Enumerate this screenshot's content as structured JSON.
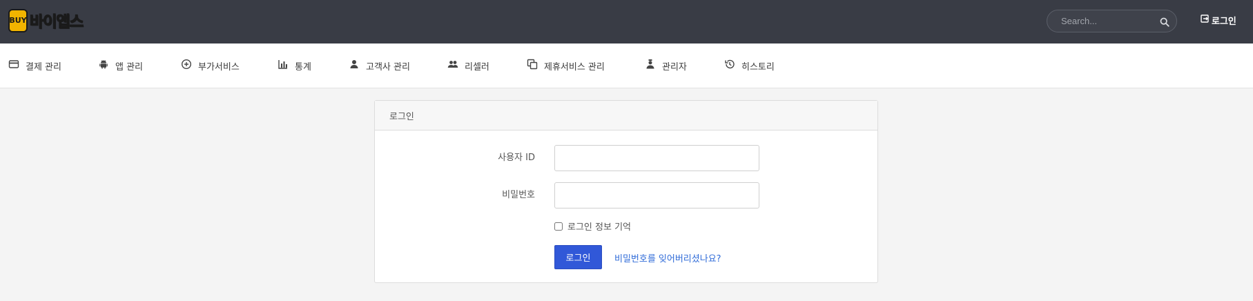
{
  "header": {
    "logo_mark": "BUY",
    "logo_text": "바이앱스",
    "search_placeholder": "Search...",
    "login_label": "로그인"
  },
  "nav": {
    "items": [
      {
        "label": "결제 관리",
        "icon": "credit-card-icon"
      },
      {
        "label": "앱 관리",
        "icon": "android-icon"
      },
      {
        "label": "부가서비스",
        "icon": "plus-circle-icon"
      },
      {
        "label": "통계",
        "icon": "bar-chart-icon"
      },
      {
        "label": "고객사 관리",
        "icon": "person-icon"
      },
      {
        "label": "리셀러",
        "icon": "people-icon"
      },
      {
        "label": "제휴서비스 관리",
        "icon": "copy-icon"
      },
      {
        "label": "관리자",
        "icon": "admin-icon"
      },
      {
        "label": "히스토리",
        "icon": "history-icon"
      }
    ]
  },
  "login_card": {
    "title": "로그인",
    "user_id_label": "사용자 ID",
    "user_id_value": "",
    "password_label": "비밀번호",
    "password_value": "",
    "remember_label": "로그인 정보 기억",
    "remember_checked": false,
    "submit_label": "로그인",
    "forgot_label": "비밀번호를 잊어버리셨나요?"
  },
  "colors": {
    "topbar": "#393c45",
    "primary_button": "#3158d8",
    "link": "#2f6bd8",
    "logo_accent": "#f2b400"
  }
}
